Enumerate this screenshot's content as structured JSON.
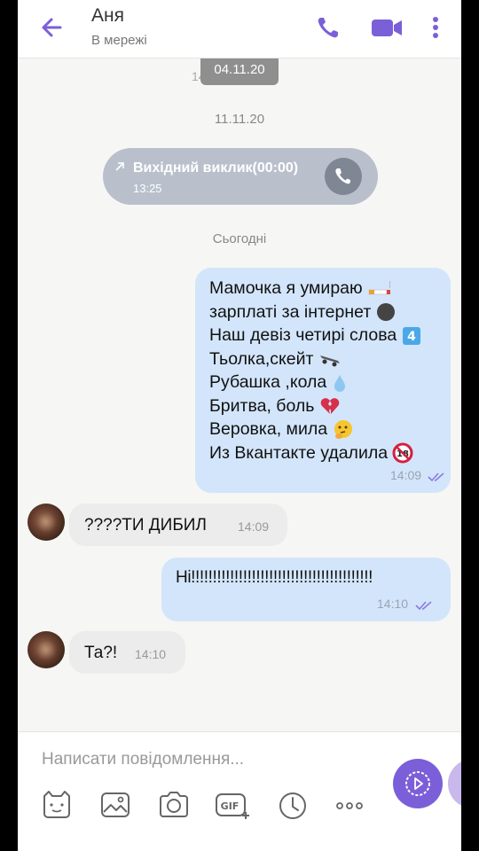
{
  "header": {
    "contact_name": "Аня",
    "status": "В мережі"
  },
  "chat": {
    "top_date_pill": "04.11.20",
    "ghost_time": "14:10",
    "date_1": "11.11.20",
    "call": {
      "label": "Вихідний виклик(00:00)",
      "time": "13:25"
    },
    "date_2": "Сьогодні",
    "messages": [
      {
        "direction": "out",
        "lines": [
          {
            "text": "Мамочка я умираю",
            "emoji": "cigarette"
          },
          {
            "text": "зарплаті за інтернет",
            "emoji": "black-circle"
          },
          {
            "text": "Наш девіз четирі слова",
            "emoji": "keycap-4"
          },
          {
            "text": "Тьолка,скейт",
            "emoji": "skateboard"
          },
          {
            "text": "Рубашка ,кола",
            "emoji": "droplet"
          },
          {
            "text": "Бритва, боль",
            "emoji": "broken-heart"
          },
          {
            "text": "Веровка, мила",
            "emoji": "thinking-face"
          },
          {
            "text": "Из Вкантакте удалила",
            "emoji": "no-under-18"
          }
        ],
        "time": "14:09",
        "status": "read"
      },
      {
        "direction": "in",
        "text": "????ТИ ДИБИЛ",
        "time": "14:09"
      },
      {
        "direction": "out",
        "text": "Ні!!!!!!!!!!!!!!!!!!!!!!!!!!!!!!!!!!!!!!!!!!",
        "time": "14:10",
        "status": "read"
      },
      {
        "direction": "in",
        "text": "Та?!",
        "time": "14:10"
      }
    ]
  },
  "composer": {
    "placeholder": "Написати повідомлення...",
    "tools": [
      "sticker-icon",
      "gallery-icon",
      "camera-icon",
      "gif-icon",
      "timer-icon",
      "more-icon"
    ]
  },
  "colors": {
    "accent": "#7b5fd8",
    "outgoing_bubble": "#d3e5fa",
    "incoming_bubble": "#ececec",
    "call_bubble": "#b9c0cc",
    "read_ticks": "#8c7ae6"
  }
}
